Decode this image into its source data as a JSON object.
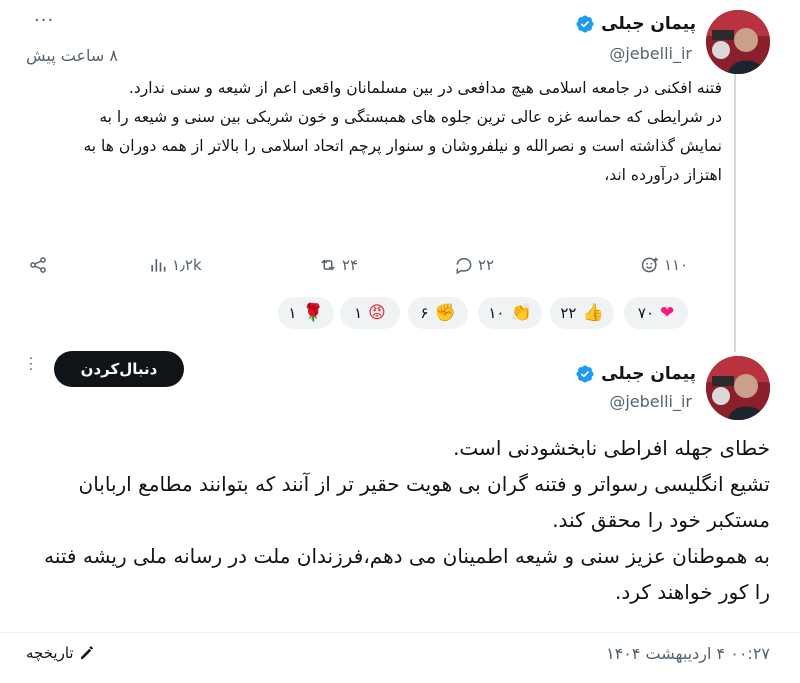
{
  "tweet1": {
    "author_name": "پیمان جبلی",
    "handle": "@jebelli_ir",
    "time": "۸ ساعت پیش",
    "more_icon": "more-dots-icon",
    "paragraphs": [
      "فتنه افکنی در جامعه اسلامی هیچ مدافعی در بین مسلمانان واقعی اعم از شیعه و سنی ندارد.",
      "در شرایطی که حماسه غزه عالی ترین جلوه های همبستگی و خون شریکی بین سنی و شیعه را به نمایش گذاشته است و نصرالله و نیلفروشان و سنوار پرچم اتحاد اسلامی را بالاتر از همه دوران ها به اهتزاز درآورده اند،"
    ],
    "actions": {
      "reply_count": "۲۲",
      "retweet_count": "۲۴",
      "like_count": "۱۱۰",
      "views_count": "۱٫۲k"
    },
    "reactions": [
      {
        "emoji": "❤",
        "count": "۷۰",
        "name": "heart",
        "color": "#f91880"
      },
      {
        "emoji": "👍",
        "count": "۲۲",
        "name": "thumbs-up",
        "color": "#ffcc4d"
      },
      {
        "emoji": "👏",
        "count": "۱۰",
        "name": "clap",
        "color": "#ffcc4d"
      },
      {
        "emoji": "✊",
        "count": "۶",
        "name": "fist",
        "color": "#ffac33"
      },
      {
        "emoji": "😡",
        "count": "۱",
        "name": "angry",
        "color": "#e0242b"
      },
      {
        "emoji": "🌹",
        "count": "۱",
        "name": "rose",
        "color": "#dd2e44"
      }
    ]
  },
  "tweet2": {
    "author_name": "پیمان جبلی",
    "handle": "@jebelli_ir",
    "follow_label": "دنبال‌کردن",
    "lines": [
      "خطای جهله افراطی نابخشودنی است.",
      "تشیع انگلیسی رسواتر و فتنه گران بی هویت حقیر تر از آنند که بتوانند مطامع اربابان مستکبر خود را محقق کند.",
      "به هموطنان عزیز سنی و شیعه اطمینان می دهم،فرزندان ملت در رسانه ملی ریشه فتنه را کور خواهند کرد."
    ],
    "timestamp": "۰۰:۲۷ ۴ اردیبهشت ۱۴۰۴",
    "history_label": "تاریخچه"
  },
  "colors": {
    "verified": "#1d9bf0",
    "secondary_text": "#536471",
    "button_bg": "#0f1419"
  }
}
